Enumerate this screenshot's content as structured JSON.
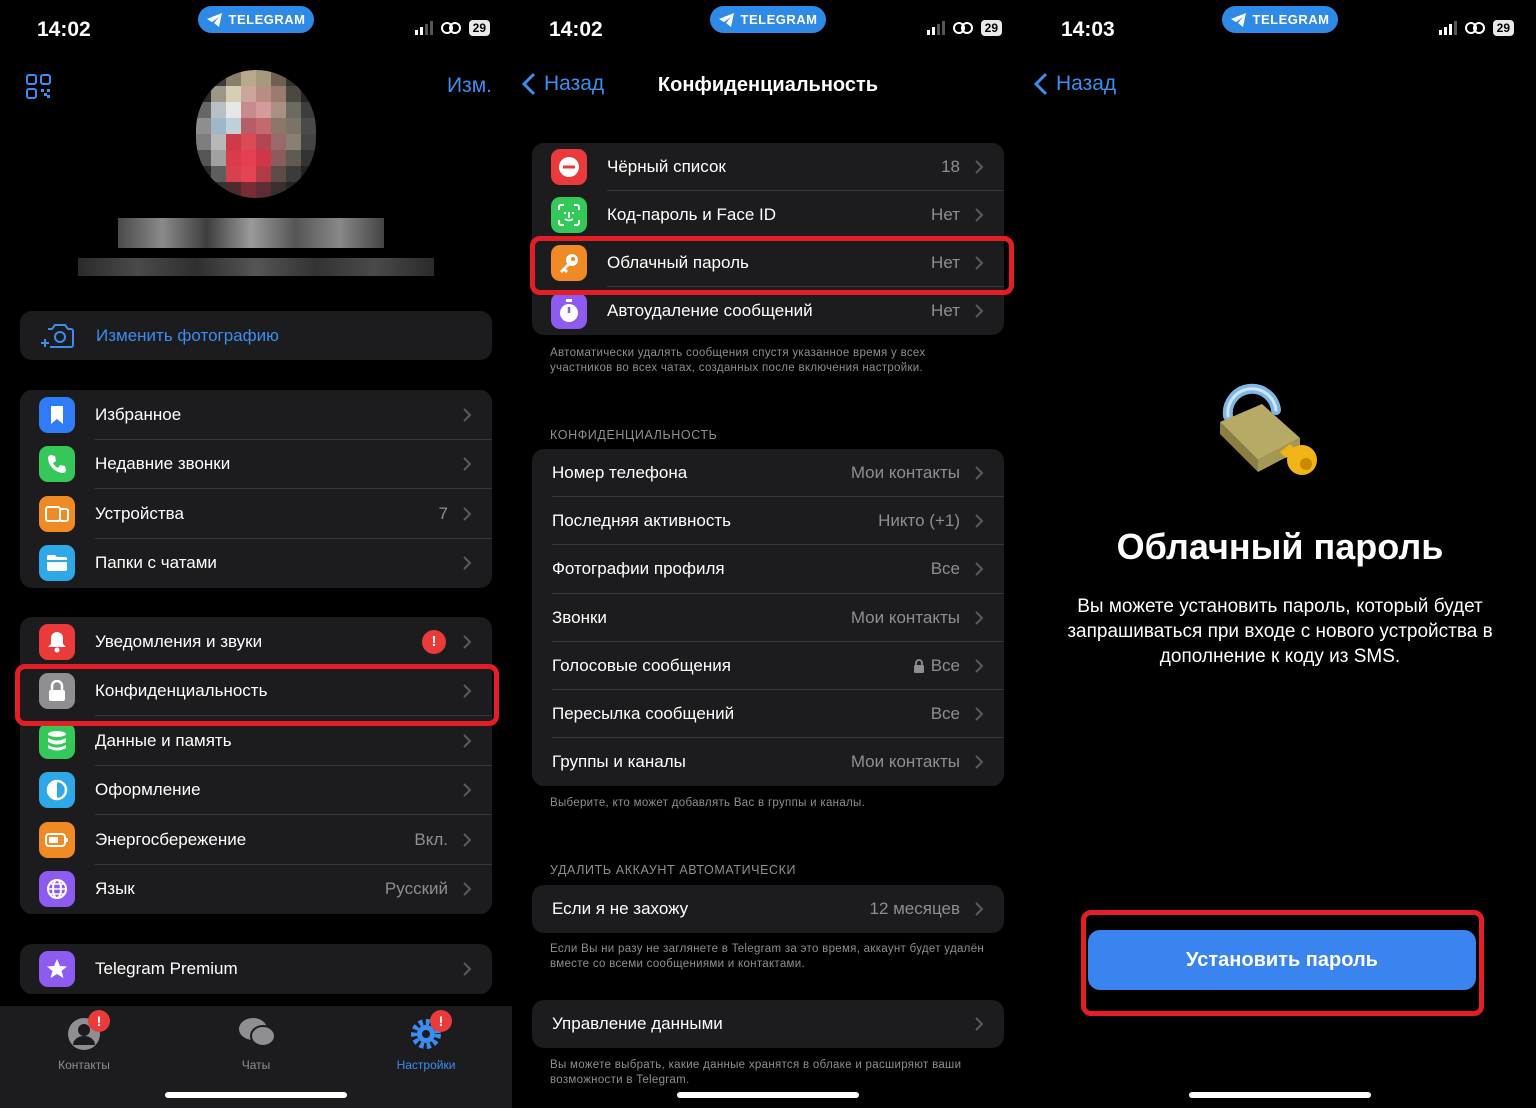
{
  "status": {
    "screens": [
      {
        "time": "14:02",
        "battery": "29",
        "pill": "TELEGRAM"
      },
      {
        "time": "14:02",
        "battery": "29",
        "pill": "TELEGRAM"
      },
      {
        "time": "14:03",
        "battery": "29",
        "pill": "TELEGRAM"
      }
    ]
  },
  "settings": {
    "edit_label": "Изм.",
    "change_photo": "Изменить фотографию",
    "group1": [
      {
        "label": "Избранное",
        "value": "",
        "icon": "bookmark-icon",
        "color": "#2f7cf6"
      },
      {
        "label": "Недавние звонки",
        "value": "",
        "icon": "phone-icon",
        "color": "#34c759"
      },
      {
        "label": "Устройства",
        "value": "7",
        "icon": "devices-icon",
        "color": "#f08a24"
      },
      {
        "label": "Папки с чатами",
        "value": "",
        "icon": "folder-icon",
        "color": "#2fa8e8"
      }
    ],
    "group2": [
      {
        "label": "Уведомления и звуки",
        "value": "",
        "icon": "bell-icon",
        "color": "#ea3a3a"
      },
      {
        "label": "Конфиденциальность",
        "value": "",
        "icon": "lock-icon",
        "color": "#8e8e93"
      },
      {
        "label": "Данные и память",
        "value": "",
        "icon": "database-icon",
        "color": "#34c759"
      },
      {
        "label": "Оформление",
        "value": "",
        "icon": "appearance-icon",
        "color": "#2fa8e8"
      },
      {
        "label": "Энергосбережение",
        "value": "Вкл.",
        "icon": "battery-icon",
        "color": "#f08a24"
      },
      {
        "label": "Язык",
        "value": "Русский",
        "icon": "globe-icon",
        "color": "#8e5bf0"
      }
    ],
    "premium": {
      "label": "Telegram Premium",
      "icon": "star-icon",
      "color": "#8e5bf0"
    },
    "notif_badge": "!",
    "tabs": [
      {
        "label": "Контакты",
        "icon": "contacts-icon",
        "badge": "!"
      },
      {
        "label": "Чаты",
        "icon": "chats-icon",
        "badge": ""
      },
      {
        "label": "Настройки",
        "icon": "settings-icon",
        "badge": "!"
      }
    ]
  },
  "privacy": {
    "back": "Назад",
    "title": "Конфиденциальность",
    "security": [
      {
        "label": "Чёрный список",
        "value": "18",
        "icon": "block-icon",
        "color": "#ea3a3a"
      },
      {
        "label": "Код-пароль и Face ID",
        "value": "Нет",
        "icon": "faceid-icon",
        "color": "#34c759"
      },
      {
        "label": "Облачный пароль",
        "value": "Нет",
        "icon": "key-icon",
        "color": "#f08a24"
      },
      {
        "label": "Автоудаление сообщений",
        "value": "Нет",
        "icon": "timer-icon",
        "color": "#8e5bf0"
      }
    ],
    "security_footer": "Автоматически удалять сообщения спустя указанное время у всех участников во всех чатах, созданных после включения настройки.",
    "privacy_header": "КОНФИДЕНЦИАЛЬНОСТЬ",
    "privacy_rows": [
      {
        "label": "Номер телефона",
        "value": "Мои контакты"
      },
      {
        "label": "Последняя активность",
        "value": "Никто (+1)"
      },
      {
        "label": "Фотографии профиля",
        "value": "Все"
      },
      {
        "label": "Звонки",
        "value": "Мои контакты"
      },
      {
        "label": "Голосовые сообщения",
        "value": "Все"
      },
      {
        "label": "Пересылка сообщений",
        "value": "Все"
      },
      {
        "label": "Группы и каналы",
        "value": "Мои контакты"
      }
    ],
    "privacy_footer": "Выберите, кто может добавлять Вас в группы и каналы.",
    "delete_header": "УДАЛИТЬ АККАУНТ АВТОМАТИЧЕСКИ",
    "delete_row": {
      "label": "Если я не захожу",
      "value": "12 месяцев"
    },
    "delete_footer": "Если Вы ни разу не заглянете в Telegram за это время, аккаунт будет удалён вместе со всеми сообщениями и контактами.",
    "data_row": {
      "label": "Управление данными"
    },
    "data_footer": "Вы можете выбрать, какие данные хранятся в облаке и расширяют ваши возможности в Telegram."
  },
  "cloud": {
    "back": "Назад",
    "title": "Облачный пароль",
    "description": "Вы можете установить пароль, который будет запрашиваться при входе с нового устройства в дополнение к коду из SMS.",
    "button": "Установить пароль"
  },
  "colors": {
    "accent": "#3b8df0",
    "button": "#3a84f0",
    "highlight": "#e31e24"
  }
}
